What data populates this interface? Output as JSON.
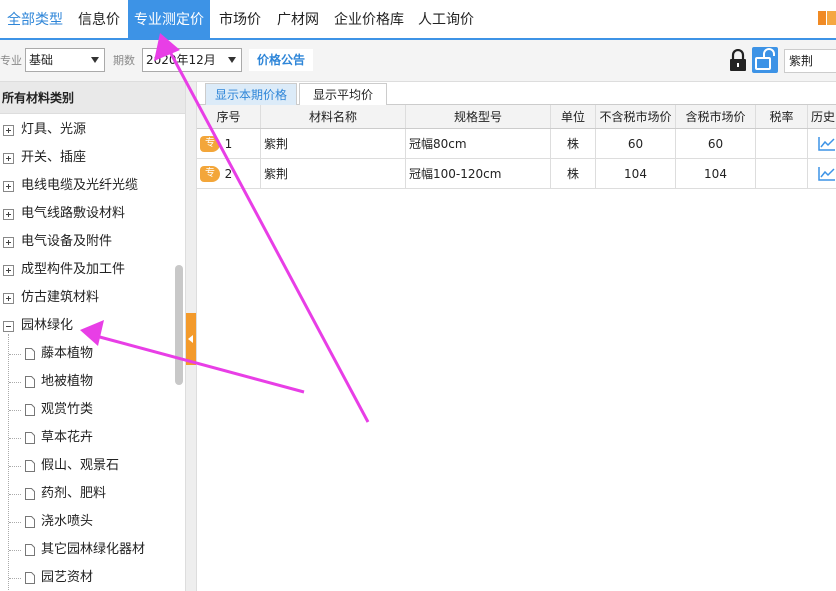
{
  "nav": {
    "items": [
      {
        "label": "全部类型"
      },
      {
        "label": "信息价"
      },
      {
        "label": "专业测定价"
      },
      {
        "label": "市场价"
      },
      {
        "label": "广材网"
      },
      {
        "label": "企业价格库"
      },
      {
        "label": "人工询价"
      }
    ]
  },
  "filter": {
    "specialty_label": "专业",
    "specialty_value": "基础",
    "period_label": "期数",
    "period_value": "2020年12月",
    "notice_label": "价格公告",
    "search_value": "紫荆"
  },
  "tree": {
    "header": "所有材料类别",
    "categories": [
      {
        "label": "灯具、光源"
      },
      {
        "label": "开关、插座"
      },
      {
        "label": "电线电缆及光纤光缆"
      },
      {
        "label": "电气线路敷设材料"
      },
      {
        "label": "电气设备及附件"
      },
      {
        "label": "成型构件及加工件"
      },
      {
        "label": "仿古建筑材料"
      },
      {
        "label": "园林绿化"
      }
    ],
    "children": [
      {
        "label": "藤本植物"
      },
      {
        "label": "地被植物"
      },
      {
        "label": "观赏竹类"
      },
      {
        "label": "草本花卉"
      },
      {
        "label": "假山、观景石"
      },
      {
        "label": "药剂、肥料"
      },
      {
        "label": "浇水喷头"
      },
      {
        "label": "其它园林绿化器材"
      },
      {
        "label": "园艺资材"
      }
    ]
  },
  "tabs": [
    {
      "label": "显示本期价格"
    },
    {
      "label": "显示平均价"
    }
  ],
  "table": {
    "columns": [
      "序号",
      "材料名称",
      "规格型号",
      "单位",
      "不含税市场价",
      "含税市场价",
      "税率",
      "历史"
    ],
    "badge": "专",
    "rows": [
      {
        "index": "1",
        "name": "紫荆",
        "spec": "冠幅80cm",
        "unit": "株",
        "price_ex_tax": "60",
        "price_inc_tax": "60",
        "tax_rate": ""
      },
      {
        "index": "2",
        "name": "紫荆",
        "spec": "冠幅100-120cm",
        "unit": "株",
        "price_ex_tax": "104",
        "price_inc_tax": "104",
        "tax_rate": ""
      }
    ]
  },
  "colors": {
    "accent": "#3d93e6",
    "badge": "#f3a63a",
    "annotation_arrow": "#e83ee6"
  }
}
